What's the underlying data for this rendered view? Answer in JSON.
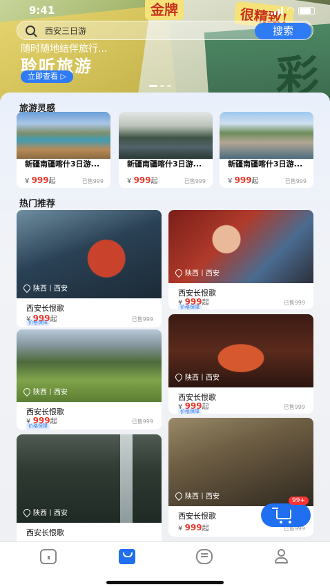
{
  "status": {
    "time": "9:41"
  },
  "hero": {
    "search_placeholder": "西安三日游",
    "search_button": "搜索",
    "subtitle": "随时随地结伴旅行...",
    "title": "聆听旅游",
    "cta": "立即查看 ▷",
    "deco_text_1": "金牌",
    "deco_text_2": "很精致!",
    "deco_text_3": "彩"
  },
  "inspiration": {
    "title": "旅游灵感",
    "items": [
      {
        "title": "新疆南疆喀什3日游...",
        "price_symbol": "¥",
        "price": "999",
        "price_suffix": "起",
        "sold": "已售999"
      },
      {
        "title": "新疆南疆喀什3日游...",
        "price_symbol": "¥",
        "price": "999",
        "price_suffix": "起",
        "sold": "已售999"
      },
      {
        "title": "新疆南疆喀什3日游...",
        "price_symbol": "¥",
        "price": "999",
        "price_suffix": "起",
        "sold": "已售999"
      }
    ]
  },
  "hot": {
    "title": "热门推荐",
    "left": [
      {
        "location": "陕西丨西安",
        "title": "西安长恨歌",
        "tag": "价格保障",
        "price_symbol": "¥",
        "price": "999",
        "price_suffix": "起",
        "sold": "已售999"
      },
      {
        "location": "陕西丨西安",
        "title": "西安长恨歌",
        "tag": "价格保障",
        "price_symbol": "¥",
        "price": "999",
        "price_suffix": "起",
        "sold": "已售999"
      },
      {
        "location": "陕西丨西安",
        "title": "西安长恨歌"
      }
    ],
    "right": [
      {
        "location": "陕西丨西安",
        "title": "西安长恨歌",
        "tag": "价格保障",
        "price_symbol": "¥",
        "price": "999",
        "price_suffix": "起",
        "sold": "已售999"
      },
      {
        "location": "陕西丨西安",
        "title": "西安长恨歌",
        "tag": "价格保障",
        "price_symbol": "¥",
        "price": "999",
        "price_suffix": "起",
        "sold": "已售999"
      },
      {
        "location": "陕西丨西安",
        "title": "西安长恨歌",
        "price_symbol": "¥",
        "price": "999",
        "price_suffix": "起",
        "sold": "已售999"
      }
    ]
  },
  "cart": {
    "badge": "99+"
  },
  "tabbar": {
    "active": "orders",
    "tabs": [
      "home-icon",
      "shopping-bag-icon",
      "message-icon",
      "profile-icon"
    ]
  }
}
